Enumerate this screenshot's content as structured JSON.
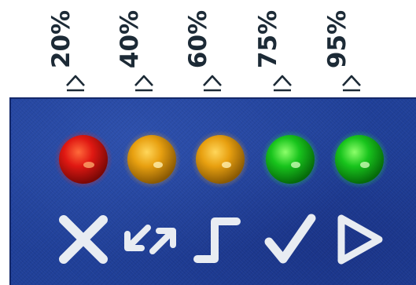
{
  "thresholds": [
    {
      "label": "20%",
      "comparator": "≥"
    },
    {
      "label": "40%",
      "comparator": "≥"
    },
    {
      "label": "60%",
      "comparator": "≥"
    },
    {
      "label": "75%",
      "comparator": "≥"
    },
    {
      "label": "95%",
      "comparator": "≥"
    }
  ],
  "leds": [
    {
      "color_name": "red",
      "color": "#e01812"
    },
    {
      "color_name": "amber",
      "color": "#e8a010"
    },
    {
      "color_name": "amber",
      "color": "#e8a010"
    },
    {
      "color_name": "green",
      "color": "#18c41c"
    },
    {
      "color_name": "green",
      "color": "#18c41c"
    }
  ],
  "icons": [
    "cross-icon",
    "bidirectional-arrows-icon",
    "step-signal-icon",
    "checkmark-icon",
    "play-triangle-icon"
  ],
  "colors": {
    "panel": "#1f3f98",
    "symbol": "#e8ecf2",
    "label": "#1c2a36"
  }
}
